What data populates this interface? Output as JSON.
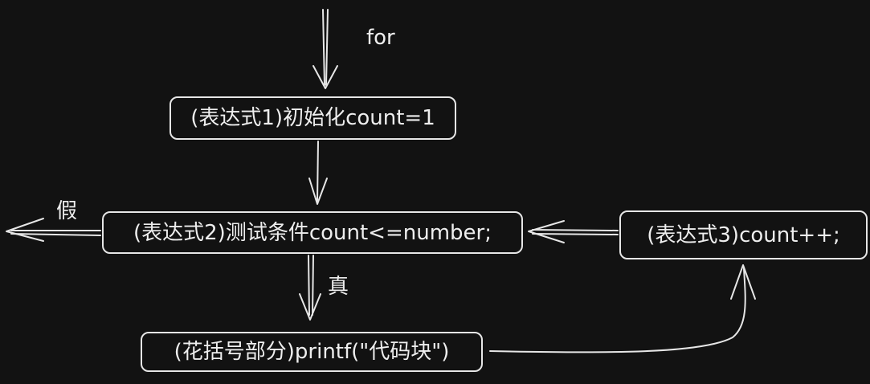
{
  "diagram": {
    "entry_label": "for",
    "nodes": {
      "init": "(表达式1)初始化count=1",
      "condition": "(表达式2)测试条件count<=number;",
      "increment": "(表达式3)count++;",
      "body": "(花括号部分)printf(\"代码块\")"
    },
    "edge_labels": {
      "false_branch": "假",
      "true_branch": "真"
    },
    "colors": {
      "background": "#121212",
      "stroke": "#e6e6e6"
    }
  }
}
